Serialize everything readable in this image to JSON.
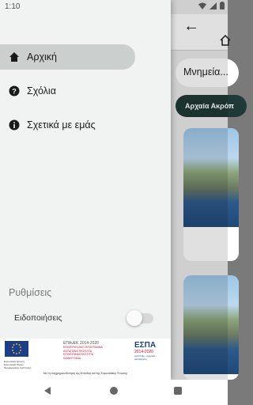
{
  "status_bar": {
    "time": "1:10"
  },
  "background": {
    "search_placeholder": "Μνημεία...",
    "chip_label": "Αρχαία Ακρόπ"
  },
  "drawer": {
    "nav_items": [
      {
        "label": "Αρχική",
        "icon": "home-icon",
        "active": true
      },
      {
        "label": "Σχόλια",
        "icon": "help-icon",
        "active": false
      },
      {
        "label": "Σχετικά με εμάς",
        "icon": "info-icon",
        "active": false
      }
    ],
    "settings_title": "Ρυθμίσεις",
    "notifications_label": "Ειδοποιήσεις",
    "notifications_enabled": false
  },
  "logos": {
    "eu_caption": "Ευρωπαϊκή Ένωση Ευρωπαϊκό Ταμείο Περιφερειακής Ανάπτυξης",
    "epanek_title": "ΕΠΑνΕΚ",
    "epanek_years": "2014-2020",
    "epanek_caption": "ΕΠΙΧΕΙΡΗΣΙΑΚΟ ΠΡΟΓΡΑΜΜΑ ΑΝΤΑΓΩΝΙΣΤΙΚΟΤΗΤΑ ΕΠΙΧΕΙΡΗΜΑΤΙΚΟΤΗΤΑ ΚΑΙΝΟΤΟΜΙΑ",
    "espa_title": "ΕΣΠΑ",
    "espa_years": "2014-2020",
    "espa_tagline": "ανάπτυξη - εργασία - αλληλεγγύη",
    "cofinance_text": "Με τη συγχρηματοδότηση της Ελλάδας και της Ευρωπαϊκής Ένωσης"
  },
  "colors": {
    "accent_dark": "#1f3a36",
    "drawer_bg": "#f1f2f2",
    "active_item_bg": "#cbcfcd"
  }
}
